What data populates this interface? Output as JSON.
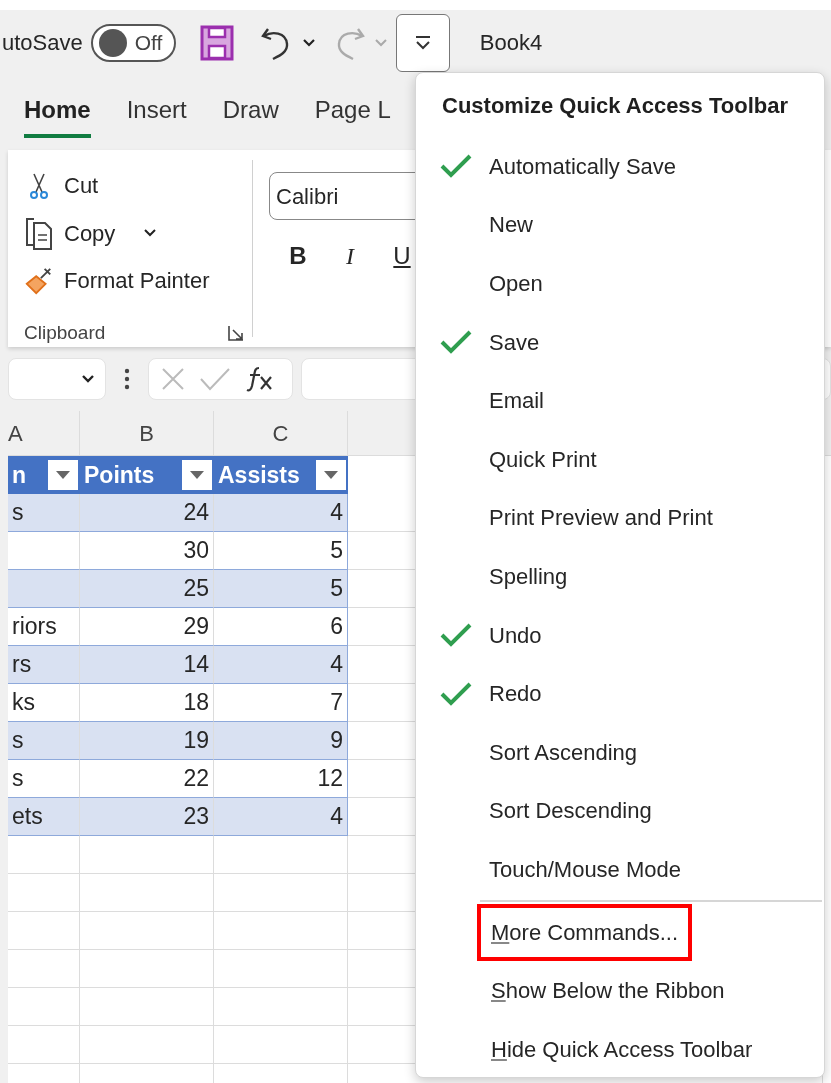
{
  "quick_access": {
    "autosave_label": "utoSave",
    "autosave_on": false,
    "autosave_state": "Off",
    "redo_disabled": true,
    "document_title": "Book4"
  },
  "ribbon_tabs": [
    {
      "label": "Home",
      "selected": true
    },
    {
      "label": "Insert",
      "selected": false
    },
    {
      "label": "Draw",
      "selected": false
    },
    {
      "label": "Page L",
      "selected": false
    }
  ],
  "clipboard": {
    "commands": [
      {
        "kind": "cut",
        "label": "Cut"
      },
      {
        "kind": "copy",
        "label": "Copy"
      },
      {
        "kind": "painter",
        "label": "Format Painter"
      }
    ],
    "group_label": "Clipboard"
  },
  "font": {
    "name": "Calibri",
    "styles": [
      {
        "kind": "bold",
        "label": "B"
      },
      {
        "kind": "italic",
        "label": "I"
      },
      {
        "kind": "underline",
        "label": "U"
      }
    ]
  },
  "column_headers": [
    "A",
    "B",
    "C"
  ],
  "table": {
    "headers": [
      "n",
      "Points",
      "Assists"
    ],
    "rows": [
      [
        "s",
        "24",
        "4"
      ],
      [
        "",
        "30",
        "5"
      ],
      [
        "",
        "25",
        "5"
      ],
      [
        "riors",
        "29",
        "6"
      ],
      [
        "rs",
        "14",
        "4"
      ],
      [
        "ks",
        "18",
        "7"
      ],
      [
        "s",
        "19",
        "9"
      ],
      [
        "s",
        "22",
        "12"
      ],
      [
        "ets",
        "23",
        "4"
      ]
    ]
  },
  "menu": {
    "title": "Customize Quick Access Toolbar",
    "items": [
      {
        "label": "Automatically Save",
        "checked": true
      },
      {
        "label": "New",
        "checked": false
      },
      {
        "label": "Open",
        "checked": false
      },
      {
        "label": "Save",
        "checked": true
      },
      {
        "label": "Email",
        "checked": false
      },
      {
        "label": "Quick Print",
        "checked": false
      },
      {
        "label": "Print Preview and Print",
        "checked": false
      },
      {
        "label": "Spelling",
        "checked": false
      },
      {
        "label": "Undo",
        "checked": true
      },
      {
        "label": "Redo",
        "checked": true
      },
      {
        "label": "Sort Ascending",
        "checked": false
      },
      {
        "label": "Sort Descending",
        "checked": false
      },
      {
        "label": "Touch/Mouse Mode",
        "checked": false
      }
    ],
    "commands": [
      {
        "label": "More Commands...",
        "mnemonic": true,
        "highlighted": true
      },
      {
        "label": "Show Below the Ribbon",
        "mnemonic": true,
        "highlighted": false
      },
      {
        "label": "Hide Quick Access Toolbar",
        "mnemonic": true,
        "highlighted": false
      }
    ]
  }
}
